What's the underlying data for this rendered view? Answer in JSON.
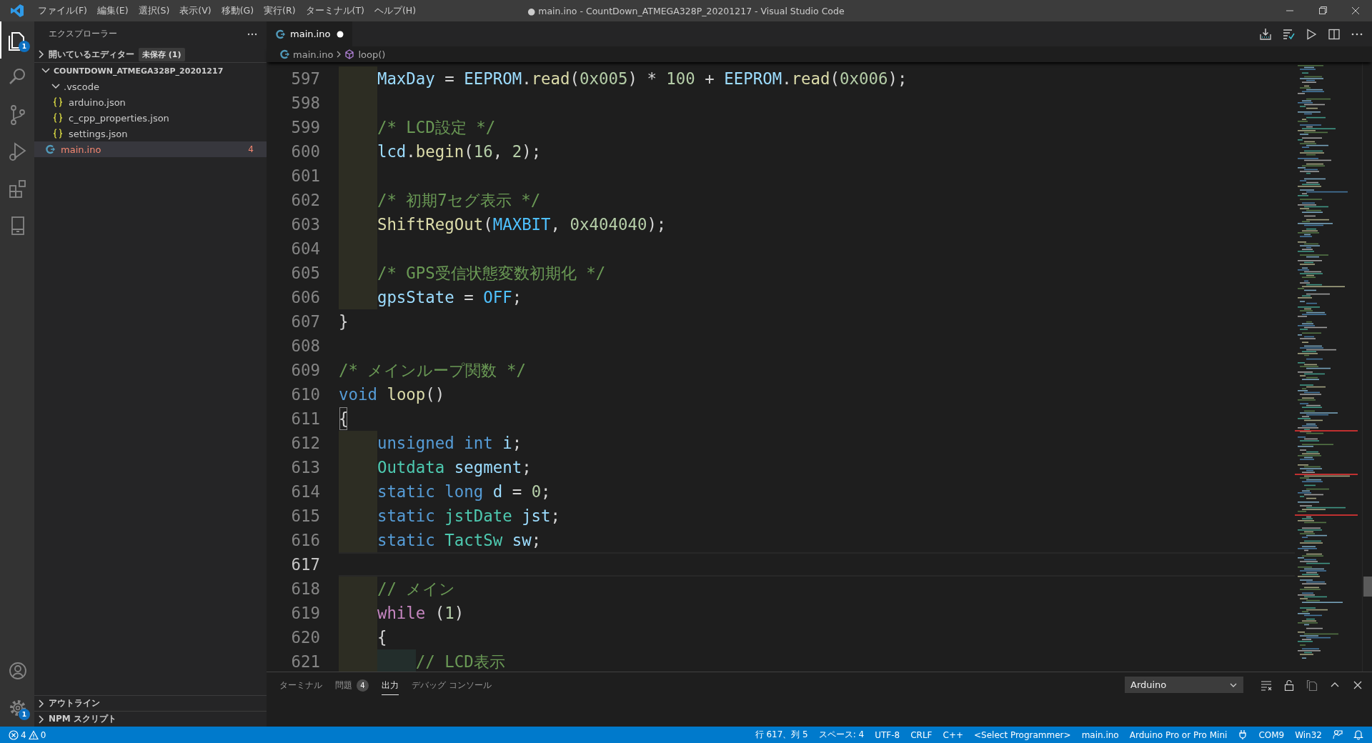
{
  "window": {
    "title": "● main.ino - CountDown_ATMEGA328P_20201217 - Visual Studio Code"
  },
  "menu": [
    "ファイル(F)",
    "編集(E)",
    "選択(S)",
    "表示(V)",
    "移動(G)",
    "実行(R)",
    "ターミナル(T)",
    "ヘルプ(H)"
  ],
  "activity_bar": {
    "items": [
      {
        "kind": "explorer",
        "selected": true,
        "badge": "1"
      },
      {
        "kind": "search",
        "selected": false
      },
      {
        "kind": "source-control",
        "selected": false
      },
      {
        "kind": "run",
        "selected": false
      },
      {
        "kind": "extensions",
        "selected": false
      },
      {
        "kind": "device",
        "selected": false
      }
    ],
    "bottom": [
      {
        "kind": "account"
      },
      {
        "kind": "settings",
        "badge": "1"
      }
    ]
  },
  "sidebar": {
    "title": "エクスプローラー",
    "open_editors": {
      "label": "開いているエディター",
      "expanded": false,
      "badge": "未保存 (1)"
    },
    "tree": [
      {
        "label": "COUNTDOWN_ATMEGA328P_20201217",
        "kind": "folder",
        "expanded": true,
        "selected": false,
        "error": false,
        "children": [
          {
            "label": ".vscode",
            "kind": "folder",
            "expanded": true,
            "selected": false,
            "error": false,
            "children": [
              {
                "label": "arduino.json",
                "kind": "json",
                "selected": false,
                "error": false
              },
              {
                "label": "c_cpp_properties.json",
                "kind": "json",
                "selected": false,
                "error": false
              },
              {
                "label": "settings.json",
                "kind": "json",
                "selected": false,
                "error": false
              }
            ]
          },
          {
            "label": "main.ino",
            "kind": "ino",
            "selected": true,
            "error": true,
            "count": "4"
          }
        ]
      }
    ],
    "sections": [
      {
        "label": "アウトライン",
        "expanded": false
      },
      {
        "label": "NPM スクリプト",
        "expanded": false
      }
    ]
  },
  "editor": {
    "tabs": [
      {
        "label": "main.ino",
        "selected": true,
        "modified": true
      }
    ],
    "breadcrumbs": [
      {
        "label": "main.ino",
        "kind": "file"
      },
      {
        "label": "loop()",
        "kind": "function"
      }
    ],
    "lines": [
      {
        "number": "597",
        "current": false,
        "tokens": [
          {
            "kind": "indent"
          },
          {
            "kind": "var",
            "text": "MaxDay"
          },
          {
            "kind": "p",
            "text": " = "
          },
          {
            "kind": "var",
            "text": "EEPROM"
          },
          {
            "kind": "p",
            "text": "."
          },
          {
            "kind": "fn",
            "text": "read"
          },
          {
            "kind": "p",
            "text": "("
          },
          {
            "kind": "num",
            "text": "0x005"
          },
          {
            "kind": "p",
            "text": ") * "
          },
          {
            "kind": "num",
            "text": "100"
          },
          {
            "kind": "p",
            "text": " + "
          },
          {
            "kind": "var",
            "text": "EEPROM"
          },
          {
            "kind": "p",
            "text": "."
          },
          {
            "kind": "fn",
            "text": "read"
          },
          {
            "kind": "p",
            "text": "("
          },
          {
            "kind": "num",
            "text": "0x006"
          },
          {
            "kind": "p",
            "text": ");"
          }
        ]
      },
      {
        "number": "598",
        "current": false,
        "tokens": [
          {
            "kind": "indent"
          }
        ]
      },
      {
        "number": "599",
        "current": false,
        "tokens": [
          {
            "kind": "indent"
          },
          {
            "kind": "cmt",
            "text": "/* LCD設定 */"
          }
        ]
      },
      {
        "number": "600",
        "current": false,
        "tokens": [
          {
            "kind": "indent"
          },
          {
            "kind": "var",
            "text": "lcd"
          },
          {
            "kind": "p",
            "text": "."
          },
          {
            "kind": "fn",
            "text": "begin"
          },
          {
            "kind": "p",
            "text": "("
          },
          {
            "kind": "num",
            "text": "16"
          },
          {
            "kind": "p",
            "text": ", "
          },
          {
            "kind": "num",
            "text": "2"
          },
          {
            "kind": "p",
            "text": ");"
          }
        ]
      },
      {
        "number": "601",
        "current": false,
        "tokens": [
          {
            "kind": "indent"
          }
        ]
      },
      {
        "number": "602",
        "current": false,
        "tokens": [
          {
            "kind": "indent"
          },
          {
            "kind": "cmt",
            "text": "/* 初期7セグ表示 */"
          }
        ]
      },
      {
        "number": "603",
        "current": false,
        "tokens": [
          {
            "kind": "indent"
          },
          {
            "kind": "fn",
            "text": "ShiftRegOut"
          },
          {
            "kind": "p",
            "text": "("
          },
          {
            "kind": "const",
            "text": "MAXBIT"
          },
          {
            "kind": "p",
            "text": ", "
          },
          {
            "kind": "num",
            "text": "0x404040"
          },
          {
            "kind": "p",
            "text": ");"
          }
        ]
      },
      {
        "number": "604",
        "current": false,
        "tokens": [
          {
            "kind": "indent"
          }
        ]
      },
      {
        "number": "605",
        "current": false,
        "tokens": [
          {
            "kind": "indent"
          },
          {
            "kind": "cmt",
            "text": "/* GPS受信状態変数初期化 */"
          }
        ]
      },
      {
        "number": "606",
        "current": false,
        "tokens": [
          {
            "kind": "indent"
          },
          {
            "kind": "var",
            "text": "gpsState"
          },
          {
            "kind": "p",
            "text": " = "
          },
          {
            "kind": "const",
            "text": "OFF"
          },
          {
            "kind": "p",
            "text": ";"
          }
        ]
      },
      {
        "number": "607",
        "current": false,
        "tokens": [
          {
            "kind": "p",
            "text": "}"
          }
        ]
      },
      {
        "number": "608",
        "current": false
      },
      {
        "number": "609",
        "current": false,
        "tokens": [
          {
            "kind": "cmt",
            "text": "/* メインループ関数 */"
          }
        ]
      },
      {
        "number": "610",
        "current": false,
        "tokens": [
          {
            "kind": "kw",
            "text": "void "
          },
          {
            "kind": "fn",
            "text": "loop"
          },
          {
            "kind": "p",
            "text": "()"
          }
        ]
      },
      {
        "number": "611",
        "current": false,
        "tokens": [
          {
            "kind": "match",
            "text": "{"
          }
        ]
      },
      {
        "number": "612",
        "current": false,
        "tokens": [
          {
            "kind": "indent"
          },
          {
            "kind": "kw",
            "text": "unsigned int "
          },
          {
            "kind": "var",
            "text": "i"
          },
          {
            "kind": "p",
            "text": ";"
          }
        ]
      },
      {
        "number": "613",
        "current": false,
        "tokens": [
          {
            "kind": "indent"
          },
          {
            "kind": "type",
            "text": "Outdata "
          },
          {
            "kind": "var",
            "text": "segment"
          },
          {
            "kind": "p",
            "text": ";"
          }
        ]
      },
      {
        "number": "614",
        "current": false,
        "tokens": [
          {
            "kind": "indent"
          },
          {
            "kind": "kw",
            "text": "static "
          },
          {
            "kind": "kw",
            "text": "long "
          },
          {
            "kind": "var",
            "text": "d"
          },
          {
            "kind": "p",
            "text": " = "
          },
          {
            "kind": "num",
            "text": "0"
          },
          {
            "kind": "p",
            "text": ";"
          }
        ]
      },
      {
        "number": "615",
        "current": false,
        "tokens": [
          {
            "kind": "indent"
          },
          {
            "kind": "kw",
            "text": "static "
          },
          {
            "kind": "type",
            "text": "jstDate "
          },
          {
            "kind": "var",
            "text": "jst"
          },
          {
            "kind": "p",
            "text": ";"
          }
        ]
      },
      {
        "number": "616",
        "current": false,
        "tokens": [
          {
            "kind": "indent"
          },
          {
            "kind": "kw",
            "text": "static "
          },
          {
            "kind": "type",
            "text": "TactSw "
          },
          {
            "kind": "var",
            "text": "sw"
          },
          {
            "kind": "p",
            "text": ";"
          }
        ]
      },
      {
        "number": "617",
        "current": true
      },
      {
        "number": "618",
        "current": false,
        "tokens": [
          {
            "kind": "indent"
          },
          {
            "kind": "cmt",
            "text": "// メイン"
          }
        ]
      },
      {
        "number": "619",
        "current": false,
        "tokens": [
          {
            "kind": "indent"
          },
          {
            "kind": "ctrl",
            "text": "while"
          },
          {
            "kind": "p",
            "text": " ("
          },
          {
            "kind": "num",
            "text": "1"
          },
          {
            "kind": "p",
            "text": ")"
          }
        ]
      },
      {
        "number": "620",
        "current": false,
        "tokens": [
          {
            "kind": "indent"
          },
          {
            "kind": "p",
            "text": "{"
          }
        ]
      },
      {
        "number": "621",
        "current": false,
        "tokens": [
          {
            "kind": "indent"
          },
          {
            "kind": "indent2"
          },
          {
            "kind": "cmt",
            "text": "// LCD表示"
          }
        ]
      }
    ]
  },
  "panel": {
    "tabs": [
      {
        "label": "ターミナル",
        "selected": false
      },
      {
        "label": "問題",
        "selected": false,
        "badge": "4"
      },
      {
        "label": "出力",
        "selected": true
      },
      {
        "label": "デバッグ コンソール",
        "selected": false
      }
    ],
    "channel": "Arduino"
  },
  "status_bar": {
    "errors": "4",
    "warnings": "0",
    "items": [
      {
        "kind": "text",
        "label": "行 617、列 5"
      },
      {
        "kind": "text",
        "label": "スペース: 4"
      },
      {
        "kind": "text",
        "label": "UTF-8"
      },
      {
        "kind": "text",
        "label": "CRLF"
      },
      {
        "kind": "text",
        "label": "C++"
      },
      {
        "kind": "text",
        "label": "<Select Programmer>"
      },
      {
        "kind": "text",
        "label": "main.ino"
      },
      {
        "kind": "text",
        "label": "Arduino Pro or Pro Mini"
      },
      {
        "kind": "plug"
      },
      {
        "kind": "text",
        "label": "COM9"
      },
      {
        "kind": "text",
        "label": "Win32"
      },
      {
        "kind": "feedback"
      },
      {
        "kind": "bell"
      }
    ]
  }
}
